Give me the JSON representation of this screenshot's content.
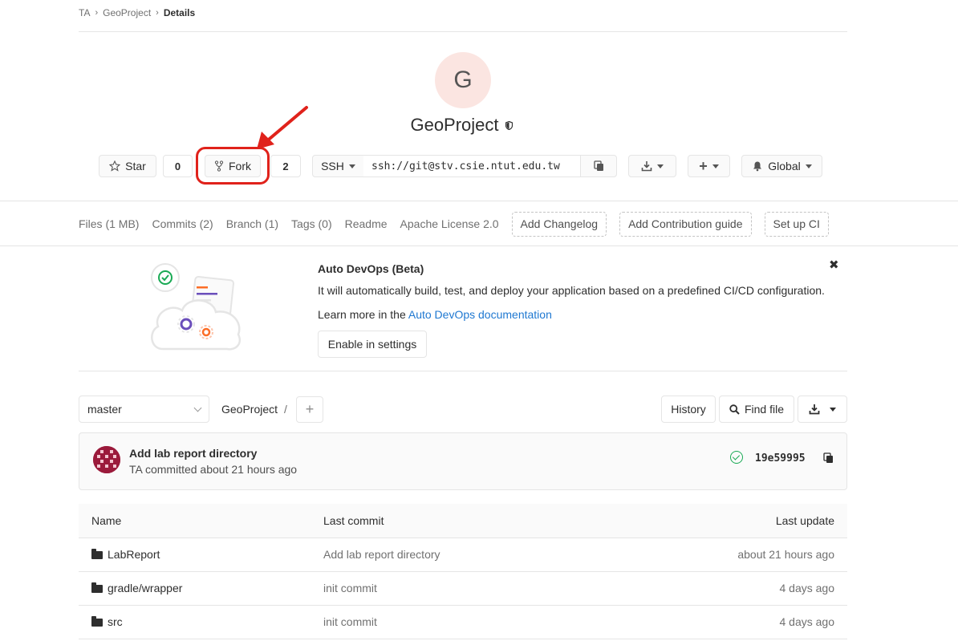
{
  "breadcrumb": {
    "items": [
      "TA",
      "GeoProject"
    ],
    "current": "Details"
  },
  "project": {
    "avatar_letter": "G",
    "name": "GeoProject",
    "visibility_icon": "shield-icon"
  },
  "actions": {
    "star_label": "Star",
    "star_count": "0",
    "fork_label": "Fork",
    "fork_count": "2",
    "clone_protocol": "SSH",
    "clone_url": "ssh://git@stv.csie.ntut.edu.tw",
    "notification_label": "Global"
  },
  "nav": {
    "items": [
      "Files (1 MB)",
      "Commits (2)",
      "Branch (1)",
      "Tags (0)",
      "Readme",
      "Apache License 2.0"
    ],
    "dashed": [
      "Add Changelog",
      "Add Contribution guide",
      "Set up CI"
    ]
  },
  "devops": {
    "title": "Auto DevOps (Beta)",
    "text": "It will automatically build, test, and deploy your application based on a predefined CI/CD configuration.",
    "learn_prefix": "Learn more in the ",
    "learn_link": "Auto DevOps documentation",
    "enable_label": "Enable in settings"
  },
  "tree": {
    "branch": "master",
    "path": "GeoProject",
    "path_sep": "/",
    "history_label": "History",
    "find_file_label": "Find file"
  },
  "commit": {
    "title": "Add lab report directory",
    "meta": "TA committed about 21 hours ago",
    "sha": "19e59995"
  },
  "files": {
    "headers": [
      "Name",
      "Last commit",
      "Last update"
    ],
    "rows": [
      {
        "name": "LabReport",
        "commit": "Add lab report directory",
        "updated": "about 21 hours ago"
      },
      {
        "name": "gradle/wrapper",
        "commit": "init commit",
        "updated": "4 days ago"
      },
      {
        "name": "src",
        "commit": "init commit",
        "updated": "4 days ago"
      }
    ]
  },
  "colors": {
    "accent": "#1f78d1",
    "highlight": "#e0221b",
    "success": "#1aaa55"
  }
}
